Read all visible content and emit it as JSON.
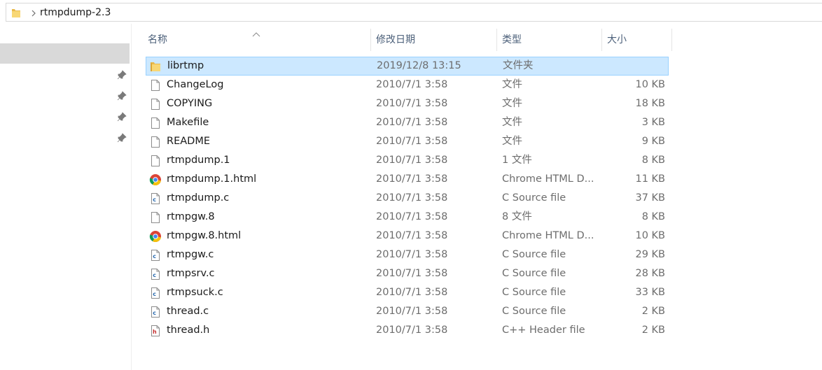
{
  "window": {
    "breadcrumb": "rtmpdump-2.3",
    "icons": {
      "folder": "folder-icon",
      "chevron": "chevron-right-icon"
    }
  },
  "columns": {
    "name": "名称",
    "date": "修改日期",
    "type": "类型",
    "size": "大小",
    "sort": "sort-ascending-icon"
  },
  "colors": {
    "selection_bg": "#cce8ff",
    "selection_border": "#99d1ff",
    "nav_selected": "#d9d9d9",
    "header_text": "#4c607a"
  },
  "files": [
    {
      "name": "librtmp",
      "date": "2019/12/8 13:15",
      "type": "文件夹",
      "size": "",
      "icon": "folder-icon",
      "selected": true
    },
    {
      "name": "ChangeLog",
      "date": "2010/7/1 3:58",
      "type": "文件",
      "size": "10 KB",
      "icon": "file-icon"
    },
    {
      "name": "COPYING",
      "date": "2010/7/1 3:58",
      "type": "文件",
      "size": "18 KB",
      "icon": "file-icon"
    },
    {
      "name": "Makefile",
      "date": "2010/7/1 3:58",
      "type": "文件",
      "size": "3 KB",
      "icon": "file-icon"
    },
    {
      "name": "README",
      "date": "2010/7/1 3:58",
      "type": "文件",
      "size": "9 KB",
      "icon": "file-icon"
    },
    {
      "name": "rtmpdump.1",
      "date": "2010/7/1 3:58",
      "type": "1 文件",
      "size": "8 KB",
      "icon": "file-icon"
    },
    {
      "name": "rtmpdump.1.html",
      "date": "2010/7/1 3:58",
      "type": "Chrome HTML D...",
      "size": "11 KB",
      "icon": "chrome-icon"
    },
    {
      "name": "rtmpdump.c",
      "date": "2010/7/1 3:58",
      "type": "C Source file",
      "size": "37 KB",
      "icon": "c-source-icon"
    },
    {
      "name": "rtmpgw.8",
      "date": "2010/7/1 3:58",
      "type": "8 文件",
      "size": "8 KB",
      "icon": "file-icon"
    },
    {
      "name": "rtmpgw.8.html",
      "date": "2010/7/1 3:58",
      "type": "Chrome HTML D...",
      "size": "10 KB",
      "icon": "chrome-icon"
    },
    {
      "name": "rtmpgw.c",
      "date": "2010/7/1 3:58",
      "type": "C Source file",
      "size": "29 KB",
      "icon": "c-source-icon"
    },
    {
      "name": "rtmpsrv.c",
      "date": "2010/7/1 3:58",
      "type": "C Source file",
      "size": "28 KB",
      "icon": "c-source-icon"
    },
    {
      "name": "rtmpsuck.c",
      "date": "2010/7/1 3:58",
      "type": "C Source file",
      "size": "33 KB",
      "icon": "c-source-icon"
    },
    {
      "name": "thread.c",
      "date": "2010/7/1 3:58",
      "type": "C Source file",
      "size": "2 KB",
      "icon": "c-source-icon"
    },
    {
      "name": "thread.h",
      "date": "2010/7/1 3:58",
      "type": "C++ Header file",
      "size": "2 KB",
      "icon": "header-file-icon"
    }
  ]
}
